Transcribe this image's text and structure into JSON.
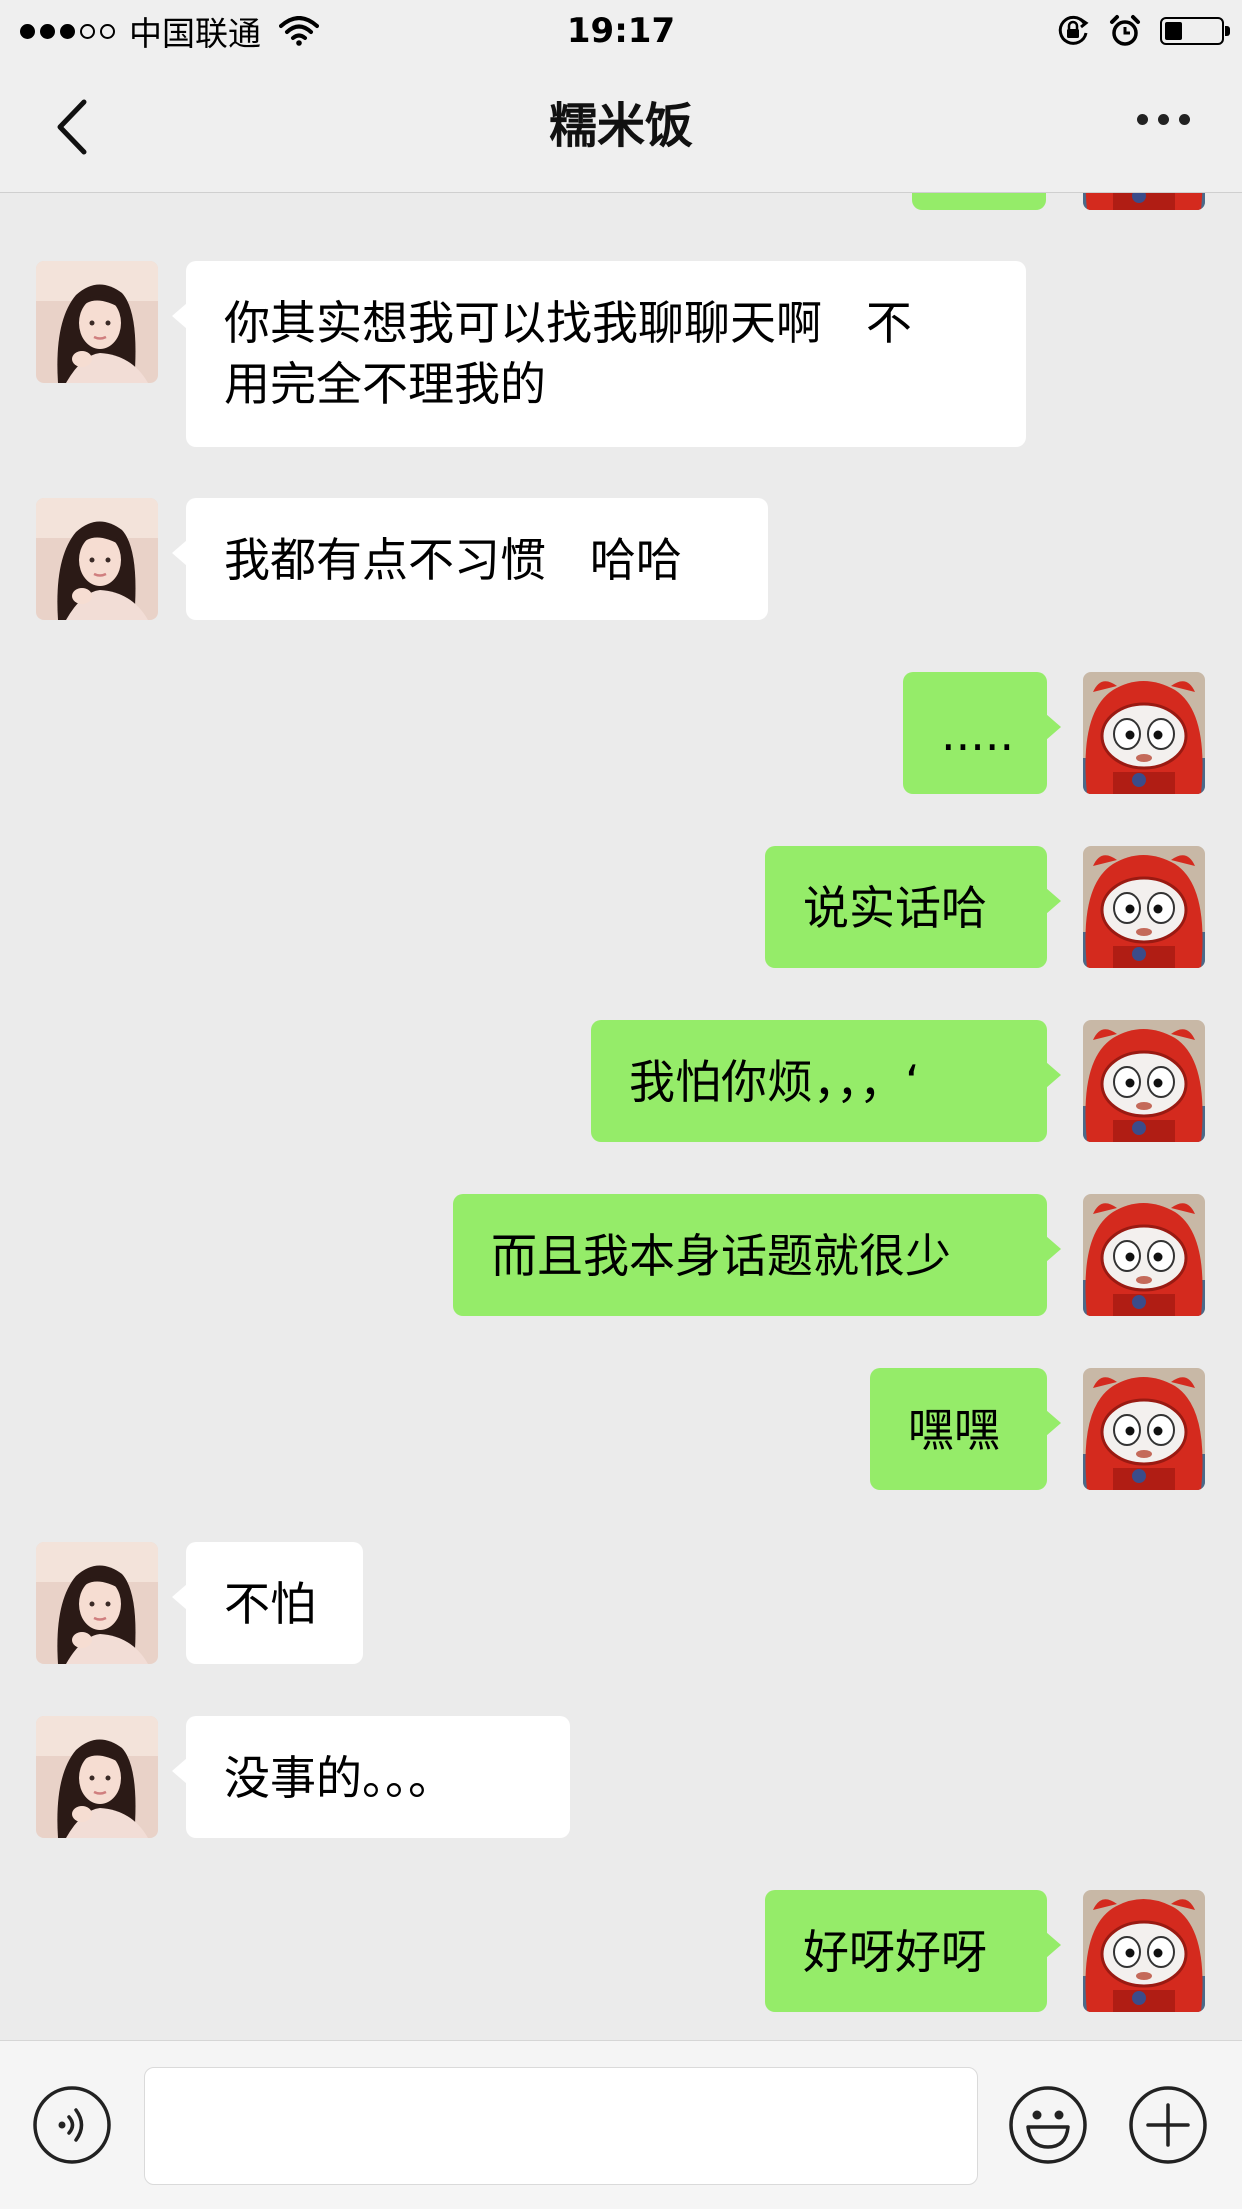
{
  "status_bar": {
    "signal_filled": 3,
    "signal_total": 5,
    "carrier": "中国联通",
    "wifi_icon": "wifi-icon",
    "time": "19:17",
    "orientation_lock_icon": "orientation-lock-icon",
    "alarm_icon": "alarm-icon",
    "battery_level": 0.3
  },
  "nav": {
    "title": "糯米饭",
    "back_icon": "chevron-left-icon",
    "more_icon": "ellipsis-icon"
  },
  "messages": [
    {
      "from": "contact",
      "text": "你其实想我可以找我聊聊天啊   不\n用完全不理我的"
    },
    {
      "from": "contact",
      "text": "我都有点不习惯   哈哈"
    },
    {
      "from": "me",
      "text": "....."
    },
    {
      "from": "me",
      "text": "说实话哈"
    },
    {
      "from": "me",
      "text": "我怕你烦，，，‘"
    },
    {
      "from": "me",
      "text": "而且我本身话题就很少"
    },
    {
      "from": "me",
      "text": "嘿嘿"
    },
    {
      "from": "contact",
      "text": "不怕"
    },
    {
      "from": "contact",
      "text": "没事的。。。"
    },
    {
      "from": "me",
      "text": "好呀好呀"
    }
  ],
  "input_bar": {
    "voice_icon": "voice-icon",
    "message_value": "",
    "emoji_icon": "emoji-icon",
    "plus_icon": "plus-icon"
  },
  "colors": {
    "background": "#ebebeb",
    "outgoing_bubble": "#95ec69",
    "incoming_bubble": "#ffffff",
    "bar": "#efefef"
  }
}
